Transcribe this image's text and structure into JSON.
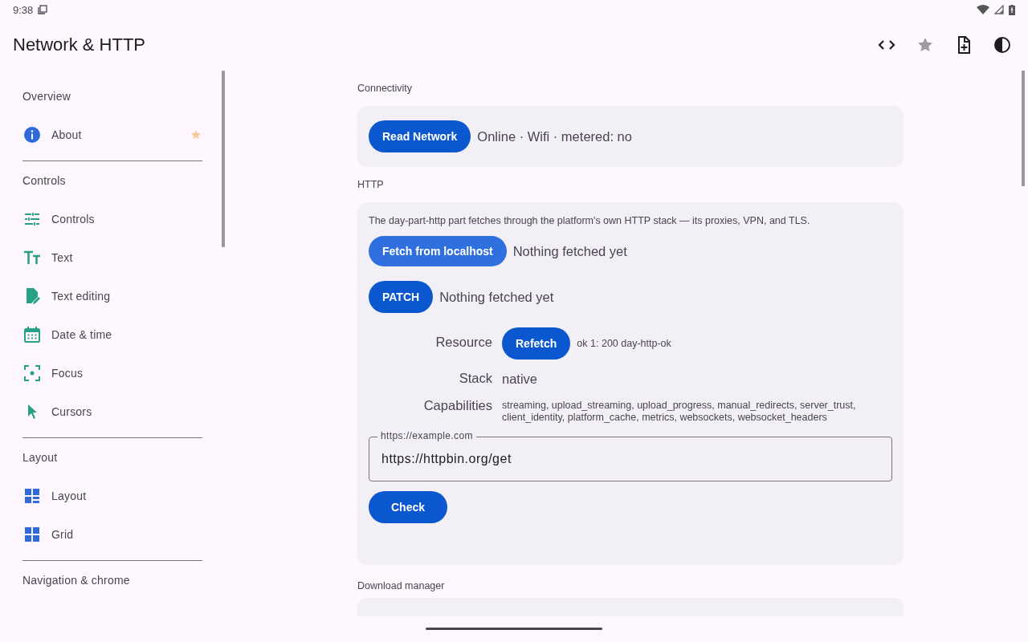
{
  "status_bar": {
    "time": "9:38"
  },
  "app_bar": {
    "title": "Network & HTTP"
  },
  "sidebar": {
    "sections": [
      {
        "title": "Overview",
        "items": [
          {
            "label": "About",
            "kind": "info",
            "starred": true
          }
        ]
      },
      {
        "title": "Controls",
        "items": [
          {
            "label": "Controls",
            "kind": "sliders",
            "starred": false
          },
          {
            "label": "Text",
            "kind": "text",
            "starred": false
          },
          {
            "label": "Text editing",
            "kind": "edit",
            "starred": false
          },
          {
            "label": "Date & time",
            "kind": "calendar",
            "starred": false
          },
          {
            "label": "Focus",
            "kind": "focus",
            "starred": false
          },
          {
            "label": "Cursors",
            "kind": "cursor",
            "starred": false
          }
        ]
      },
      {
        "title": "Layout",
        "items": [
          {
            "label": "Layout",
            "kind": "layout",
            "starred": false
          },
          {
            "label": "Grid",
            "kind": "grid",
            "starred": false
          }
        ]
      },
      {
        "title": "Navigation & chrome"
      }
    ]
  },
  "connectivity": {
    "heading": "Connectivity",
    "button": "Read Network",
    "status": "Online · Wifi · metered: no"
  },
  "http": {
    "heading": "HTTP",
    "description": "The day-part-http part fetches through the platform's own HTTP stack — its proxies, VPN, and TLS.",
    "actions": [
      {
        "button": "Fetch from localhost",
        "kind": "tonal",
        "result": "Nothing fetched yet"
      },
      {
        "button": "PATCH",
        "kind": "filled",
        "result": "Nothing fetched yet"
      }
    ],
    "details": [
      {
        "label": "Resource",
        "kind": "button",
        "button": "Refetch",
        "value": "ok 1: 200 day-http-ok"
      },
      {
        "label": "Stack",
        "kind": "text",
        "value": "native"
      },
      {
        "label": "Capabilities",
        "kind": "small",
        "value": "streaming, upload_streaming, upload_progress, manual_redirects, server_trust, client_identity, platform_cache, metrics, websockets, websocket_headers"
      }
    ],
    "url_field": {
      "label": "https://example.com",
      "value": "https://httpbin.org/get"
    },
    "check_button": "Check"
  },
  "download_manager": {
    "heading": "Download manager"
  }
}
